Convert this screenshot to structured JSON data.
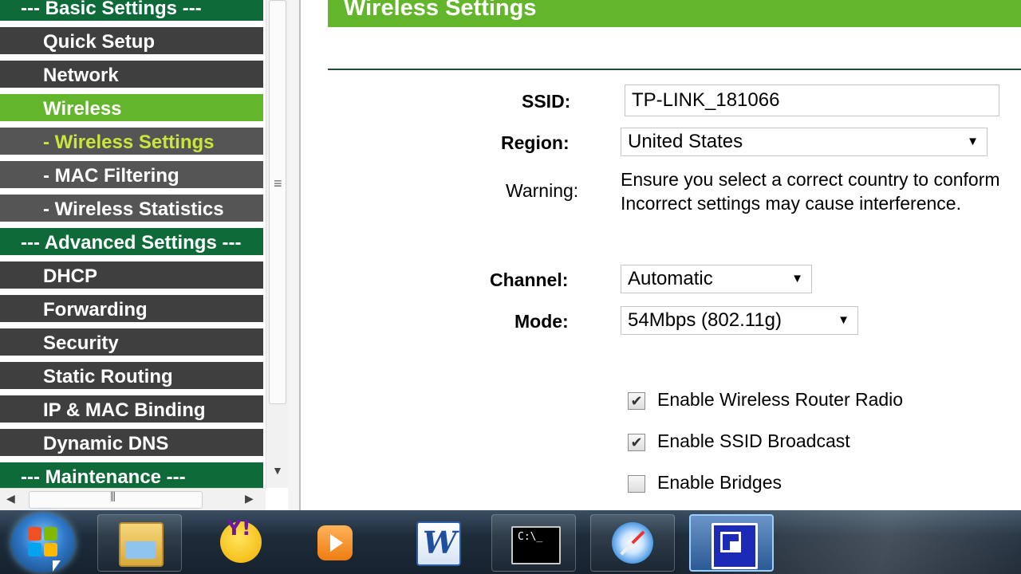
{
  "sidebar": {
    "items": [
      {
        "label": "--- Basic Settings ---",
        "kind": "header"
      },
      {
        "label": "Quick Setup",
        "kind": "plain"
      },
      {
        "label": "Network",
        "kind": "plain"
      },
      {
        "label": "Wireless",
        "kind": "active"
      },
      {
        "label": "- Wireless Settings",
        "kind": "sub-current"
      },
      {
        "label": "- MAC Filtering",
        "kind": "sub"
      },
      {
        "label": "- Wireless Statistics",
        "kind": "sub"
      },
      {
        "label": "--- Advanced Settings ---",
        "kind": "header"
      },
      {
        "label": "DHCP",
        "kind": "plain"
      },
      {
        "label": "Forwarding",
        "kind": "plain"
      },
      {
        "label": "Security",
        "kind": "plain"
      },
      {
        "label": "Static Routing",
        "kind": "plain"
      },
      {
        "label": "IP & MAC Binding",
        "kind": "plain"
      },
      {
        "label": "Dynamic DNS",
        "kind": "plain"
      },
      {
        "label": "--- Maintenance ---",
        "kind": "header"
      }
    ]
  },
  "main": {
    "title": "Wireless Settings",
    "ssid": {
      "label": "SSID:",
      "value": "TP-LINK_181066"
    },
    "region": {
      "label": "Region:",
      "value": "United States"
    },
    "warning": {
      "label": "Warning:",
      "line1": "Ensure you select a correct country to conform",
      "line2": "Incorrect settings may cause interference."
    },
    "channel": {
      "label": "Channel:",
      "value": "Automatic"
    },
    "mode": {
      "label": "Mode:",
      "value": "54Mbps (802.11g)"
    },
    "checkboxes": [
      {
        "label": "Enable Wireless Router Radio",
        "checked": true
      },
      {
        "label": "Enable SSID Broadcast",
        "checked": true
      },
      {
        "label": "Enable Bridges",
        "checked": false
      }
    ]
  },
  "taskbar": {
    "apps": [
      "start-orb",
      "windows-explorer-icon",
      "yahoo-messenger-icon",
      "media-player-icon",
      "word-icon",
      "command-prompt-icon",
      "safari-icon",
      "remote-desktop-icon"
    ],
    "cmd_text": "C:\\_"
  },
  "colors": {
    "header_green": "#0e6b39",
    "active_green": "#63b52b",
    "nav_dark": "#3f3f3f",
    "nav_sub": "#555555",
    "sub_current_text": "#c8e63c"
  }
}
